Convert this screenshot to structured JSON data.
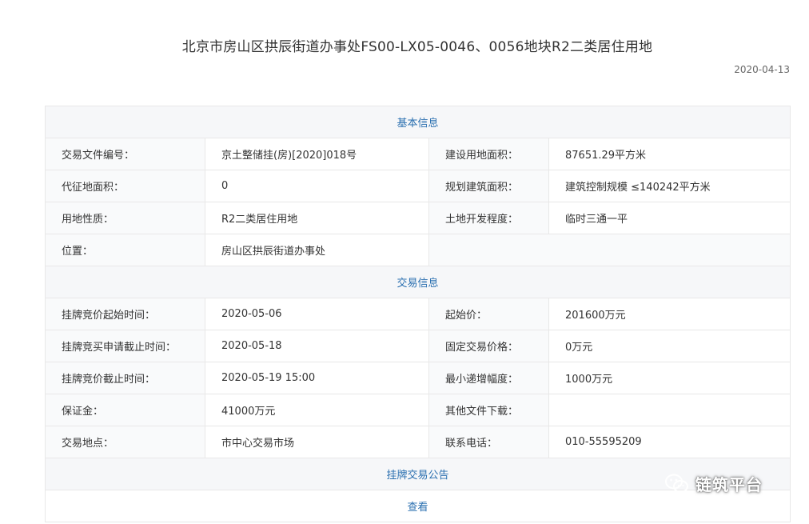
{
  "page": {
    "title": "北京市房山区拱辰街道办事处FS00-LX05-0046、0056地块R2二类居住用地",
    "date": "2020-04-13"
  },
  "basic_info": {
    "section_title": "基本信息",
    "rows": [
      [
        {
          "label": "交易文件编号：",
          "value": "京土整储挂(房)[2020]018号"
        },
        {
          "label": "建设用地面积：",
          "value": "87651.29平方米"
        }
      ],
      [
        {
          "label": "代征地面积：",
          "value": "0"
        },
        {
          "label": "规划建筑面积：",
          "value": "建筑控制规模 ≤140242平方米"
        }
      ],
      [
        {
          "label": "用地性质：",
          "value": "R2二类居住用地"
        },
        {
          "label": "土地开发程度：",
          "value": "临时三通一平"
        }
      ],
      [
        {
          "label": "位置：",
          "value": "房山区拱辰街道办事处"
        }
      ]
    ]
  },
  "trade_info": {
    "section_title": "交易信息",
    "rows": [
      [
        {
          "label": "挂牌竞价起始时间：",
          "value": "2020-05-06"
        },
        {
          "label": "起始价：",
          "value": "201600万元"
        }
      ],
      [
        {
          "label": "挂牌竞买申请截止时间：",
          "value": "2020-05-18"
        },
        {
          "label": "固定交易价格：",
          "value": "0万元"
        }
      ],
      [
        {
          "label": "挂牌竞价截止时间：",
          "value": "2020-05-19 15:00"
        },
        {
          "label": "最小递增幅度：",
          "value": "1000万元"
        }
      ],
      [
        {
          "label": "保证金：",
          "value": "41000万元"
        },
        {
          "label": "其他文件下载：",
          "value": ""
        }
      ],
      [
        {
          "label": "交易地点：",
          "value": "市中心交易市场"
        },
        {
          "label": "联系电话：",
          "value": "010-55595209"
        }
      ]
    ]
  },
  "announcement": {
    "section_title": "挂牌交易公告",
    "view_link": "查看"
  },
  "watermark": {
    "icon": "wechat-icon",
    "text": "链筑平台"
  }
}
